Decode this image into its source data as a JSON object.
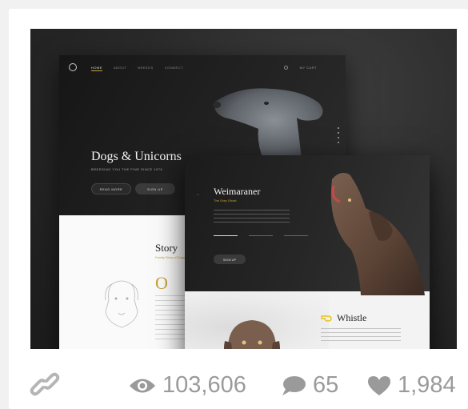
{
  "shot": {
    "back_page": {
      "nav_items": [
        "HOME",
        "ABOUT",
        "BREEDS",
        "CONNECT"
      ],
      "nav_right": "MY CART",
      "title": "Dogs & Unicorns",
      "subtitle": "BREEDING YOU THE FINE SINCE 1976",
      "read_more": "READ MORE",
      "sign_up": "SIGN UP",
      "story_title": "Story",
      "story_subtitle": "Family Story of Dogs",
      "drop_cap": "O"
    },
    "front_page": {
      "title": "Weimaraner",
      "subtitle": "The Grey Ghost",
      "sign_up": "SIGN UP",
      "whistle_title": "Whistle"
    }
  },
  "stats": {
    "views": "103,606",
    "comments": "65",
    "likes": "1,984"
  },
  "icons": {
    "link": "link-icon",
    "views": "eye-icon",
    "comments": "speech-bubble-icon",
    "likes": "heart-icon"
  },
  "colors": {
    "accent": "#c8a13a",
    "stat_gray": "#9a9a9a",
    "card": "#ffffff",
    "background": "#f1f1f1"
  }
}
